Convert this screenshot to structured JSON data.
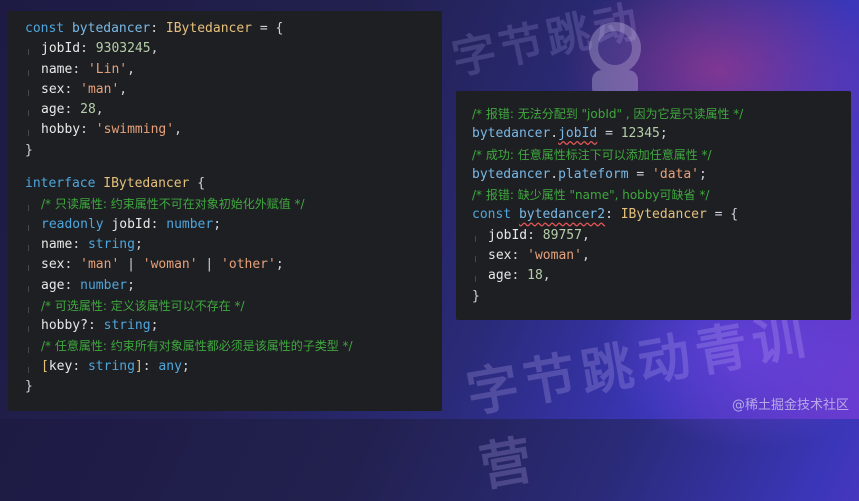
{
  "background": {
    "watermark_top": "字节跳动",
    "watermark_bottom": "字节跳动青训营",
    "credit": "@稀土掘金技术社区"
  },
  "left_code": {
    "l1": {
      "kw": "const",
      "name": "bytedancer",
      "colon": ":",
      "type": "IBytedancer",
      "rest": " = {"
    },
    "l2": {
      "key": "jobId",
      "val": "9303245",
      "end": ","
    },
    "l3": {
      "key": "name",
      "val": "'Lin'",
      "end": ","
    },
    "l4": {
      "key": "sex",
      "val": "'man'",
      "end": ","
    },
    "l5": {
      "key": "age",
      "val": "28",
      "end": ","
    },
    "l6": {
      "key": "hobby",
      "val": "'swimming'",
      "end": ","
    },
    "l7": "}",
    "l8": {
      "kw": "interface",
      "type": "IBytedancer",
      "rest": " {"
    },
    "l9": "/* 只读属性: 约束属性不可在对象初始化外赋值 */",
    "l10": {
      "kw": "readonly",
      "key": "jobId",
      "type": "number",
      "end": ";"
    },
    "l11": {
      "key": "name",
      "type": "string",
      "end": ";"
    },
    "l12": {
      "key": "sex",
      "v1": "'man'",
      "v2": "'woman'",
      "v3": "'other'",
      "sep": " | ",
      "end": ";"
    },
    "l13": {
      "key": "age",
      "type": "number",
      "end": ";"
    },
    "l14": "/* 可选属性: 定义该属性可以不存在 */",
    "l15": {
      "key": "hobby?",
      "type": "string",
      "end": ";"
    },
    "l16": "/* 任意属性: 约束所有对象属性都必须是该属性的子类型 */",
    "l17": {
      "open": "[",
      "key": "key",
      "type": "string",
      "close": "]",
      "type2": "any",
      "end": ";"
    },
    "l18": "}"
  },
  "right_code": {
    "r1": "/* 报错: 无法分配到 \"jobId\" , 因为它是只读属性 */",
    "r2": {
      "obj": "bytedancer",
      "prop": "jobId",
      "rest": " = ",
      "val": "12345",
      "end": ";"
    },
    "r3": "/* 成功: 任意属性标注下可以添加任意属性 */",
    "r4": {
      "obj": "bytedancer",
      "prop": "plateform",
      "rest": " = ",
      "val": "'data'",
      "end": ";"
    },
    "r5": "/* 报错: 缺少属性 \"name\", hobby可缺省 */",
    "r6": {
      "kw": "const",
      "name": "bytedancer2",
      "colon": ":",
      "type": "IBytedancer",
      "rest": " = {"
    },
    "r7": {
      "key": "jobId",
      "val": "89757",
      "end": ","
    },
    "r8": {
      "key": "sex",
      "val": "'woman'",
      "end": ","
    },
    "r9": {
      "key": "age",
      "val": "18",
      "end": ","
    },
    "r10": "}"
  },
  "colors": {
    "keyword": "#4fa6dc",
    "type": "#e5c07b",
    "string": "#e6a17a",
    "comment": "#3fa83f",
    "error_underline": "#e05555",
    "panel_bg": "#1e1f22"
  }
}
